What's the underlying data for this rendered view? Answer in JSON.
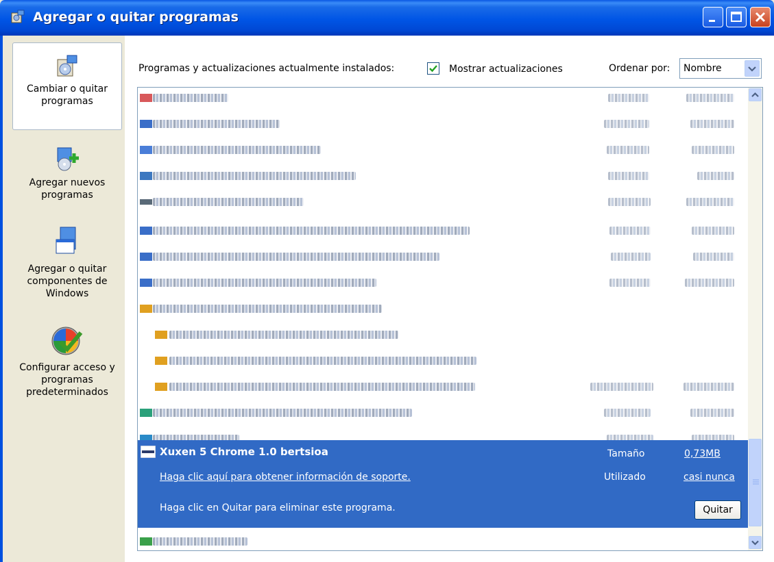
{
  "window": {
    "title": "Agregar o quitar programas"
  },
  "sidebar": {
    "items": [
      {
        "label": "Cambiar o quitar programas",
        "icon": "change-remove-programs-icon"
      },
      {
        "label": "Agregar nuevos programas",
        "icon": "add-programs-icon"
      },
      {
        "label": "Agregar o quitar componentes de Windows",
        "icon": "windows-components-icon"
      },
      {
        "label": "Configurar acceso y programas predeterminados",
        "icon": "default-programs-icon"
      }
    ]
  },
  "header": {
    "installed_label": "Programas y actualizaciones actualmente instalados:",
    "show_updates_label": "Mostrar actualizaciones",
    "show_updates_checked": true,
    "sort_label": "Ordenar por:",
    "sort_value": "Nombre"
  },
  "selected_program": {
    "name": "Xuxen 5 Chrome 1.0 bertsioa",
    "size_label": "Tamaño",
    "size_value": "0,73MB",
    "used_label": "Utilizado",
    "used_value": "casi nunca",
    "support_link": "Haga clic aquí para obtener información de soporte.",
    "remove_hint": "Haga clic en Quitar para eliminar este programa.",
    "remove_button": "Quitar"
  },
  "colors": {
    "selection": "#316AC5",
    "titlebar": "#0055E5",
    "sidebar_bg": "#ECE9D8"
  }
}
